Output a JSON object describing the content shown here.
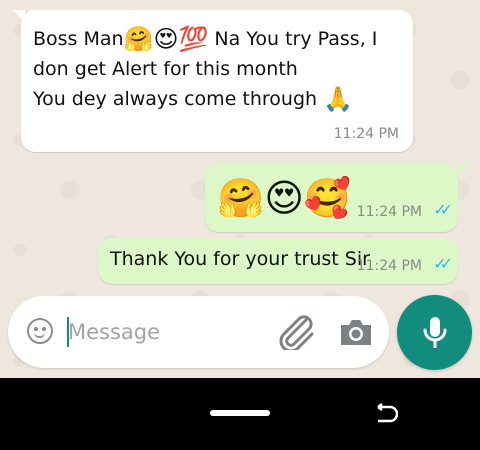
{
  "messages": [
    {
      "direction": "incoming",
      "lines": [
        {
          "text": "Boss Man",
          "emojis": "🤗😍💯",
          "after": " Na You try Pass, I"
        },
        {
          "text": "don get Alert for this month"
        },
        {
          "text": "You dey always come through ",
          "emojis": "🙏"
        }
      ],
      "time": "11:24 PM"
    },
    {
      "direction": "outgoing",
      "emojis": "🤗😍🥰",
      "time": "11:24 PM",
      "status": "read",
      "ticks": "✓✓"
    },
    {
      "direction": "outgoing",
      "text": "Thank You for your trust Sir",
      "time": "11:24 PM",
      "status": "read",
      "ticks": "✓✓"
    }
  ],
  "composer": {
    "placeholder": "Message",
    "icons": [
      "emoji-icon",
      "paperclip-icon",
      "camera-icon",
      "microphone-icon"
    ]
  },
  "navbar": {
    "icons": [
      "home-pill",
      "rotate-icon"
    ]
  },
  "colors": {
    "outgoing_bubble": "#dcf8c6",
    "incoming_bubble": "#ffffff",
    "accent": "#128c7e",
    "read_tick": "#34b7f1"
  }
}
